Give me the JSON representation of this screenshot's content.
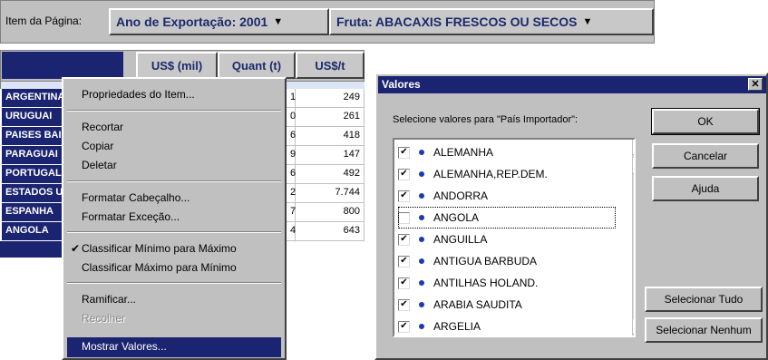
{
  "page_item": {
    "label": "Item da Página:",
    "fields": [
      {
        "label": "Ano de Exportação: 2001"
      },
      {
        "label": "Fruta: ABACAXIS FRESCOS OU SECOS"
      }
    ]
  },
  "pivot": {
    "columns": [
      "US$ (mil)",
      "Quant (t)",
      "US$/t"
    ],
    "rows": [
      {
        "label": "ARGENTINA",
        "quant_tail": "1",
        "price": "249"
      },
      {
        "label": "URUGUAI",
        "quant_tail": "0",
        "price": "261"
      },
      {
        "label": "PAISES BAIXOS",
        "quant_tail": "6",
        "price": "418"
      },
      {
        "label": "PARAGUAI",
        "quant_tail": "9",
        "price": "147"
      },
      {
        "label": "PORTUGAL",
        "quant_tail": "6",
        "price": "492"
      },
      {
        "label": "ESTADOS UNIDOS",
        "quant_tail": "2",
        "price": "7.744"
      },
      {
        "label": "ESPANHA",
        "quant_tail": "7",
        "price": "800"
      },
      {
        "label": "ANGOLA",
        "quant_tail": "4",
        "price": "643"
      }
    ]
  },
  "context_menu": {
    "items": [
      {
        "label": "Propriedades do Item..."
      },
      {
        "label": "Recortar"
      },
      {
        "label": "Copiar"
      },
      {
        "label": "Deletar"
      },
      {
        "label": "Formatar Cabeçalho..."
      },
      {
        "label": "Formatar Exceção..."
      },
      {
        "label": "Classificar Mínimo para Máximo",
        "checked": true
      },
      {
        "label": "Classificar Máximo para Mínimo"
      },
      {
        "label": "Ramificar..."
      },
      {
        "label": "Recolher",
        "disabled": true
      },
      {
        "label": "Mostrar Valores...",
        "selected": true
      }
    ]
  },
  "dialog": {
    "title": "Valores",
    "close": "✕",
    "prompt": "Selecione valores para \"País Importador\":",
    "items": [
      {
        "label": "ALEMANHA",
        "checked": true
      },
      {
        "label": "ALEMANHA,REP.DEM.",
        "checked": true
      },
      {
        "label": "ANDORRA",
        "checked": true
      },
      {
        "label": "ANGOLA",
        "checked": false
      },
      {
        "label": "ANGUILLA",
        "checked": true
      },
      {
        "label": "ANTIGUA BARBUDA",
        "checked": true
      },
      {
        "label": "ANTILHAS HOLAND.",
        "checked": true
      },
      {
        "label": "ARABIA SAUDITA",
        "checked": true
      },
      {
        "label": "ARGELIA",
        "checked": true
      }
    ],
    "buttons": {
      "ok": "OK",
      "cancel": "Cancelar",
      "help": "Ajuda",
      "select_all": "Selecionar Tudo",
      "select_none": "Selecionar Nenhum"
    }
  }
}
